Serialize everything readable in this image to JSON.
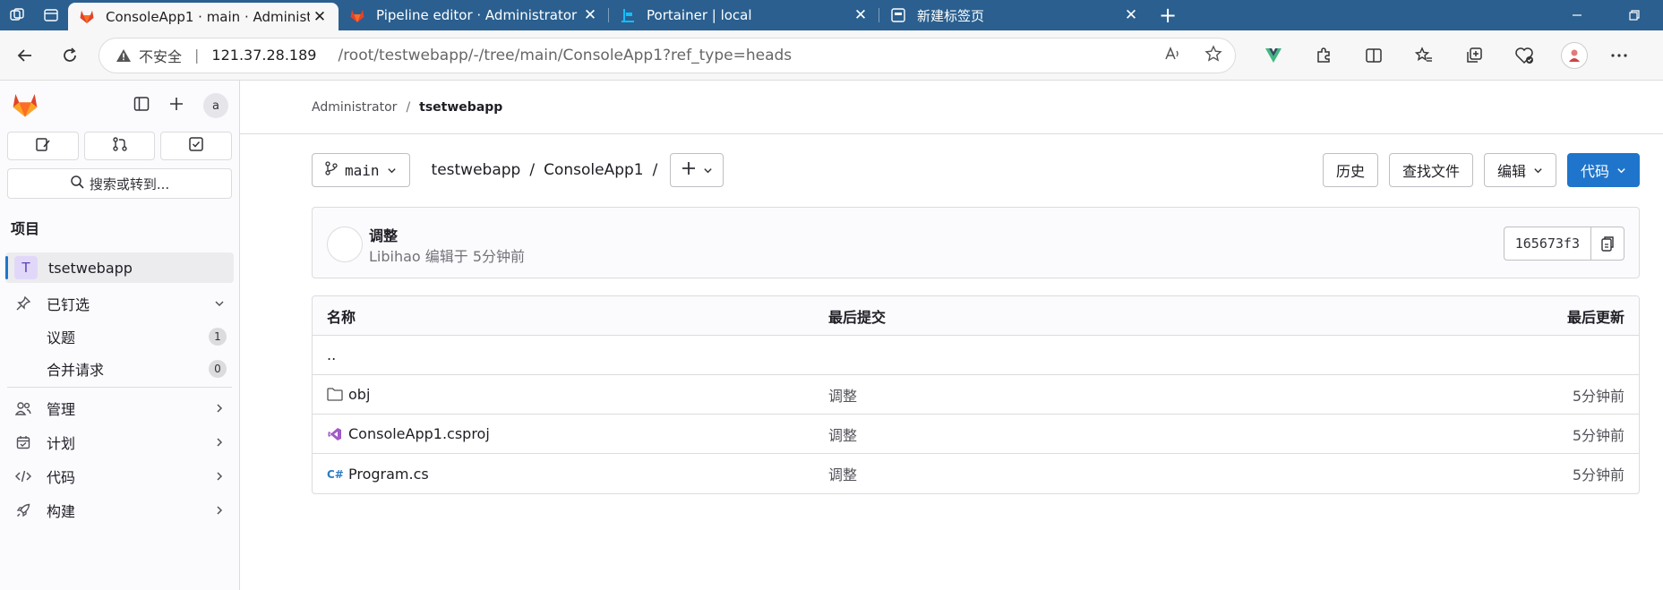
{
  "browser": {
    "tabs": [
      {
        "title": "ConsoleApp1 · main · Administrat",
        "active": true
      },
      {
        "title": "Pipeline editor · Administrator / ts",
        "active": false
      },
      {
        "title": "Portainer | local",
        "active": false
      },
      {
        "title": "新建标签页",
        "active": false
      }
    ],
    "address": {
      "insecure_label": "不安全",
      "host": "121.37.28.189",
      "path": "/root/testwebapp/-/tree/main/ConsoleApp1?ref_type=heads"
    }
  },
  "sidebar": {
    "avatar_alt": "a",
    "search_label": "搜索或转到...",
    "section_heading": "项目",
    "project": {
      "initial": "T",
      "name": "tsetwebapp"
    },
    "pinned_label": "已钉选",
    "pinned_items": [
      {
        "label": "议题",
        "count": "1"
      },
      {
        "label": "合并请求",
        "count": "0"
      }
    ],
    "nav_items": [
      {
        "label": "管理",
        "icon": "users-icon"
      },
      {
        "label": "计划",
        "icon": "calendar-icon"
      },
      {
        "label": "代码",
        "icon": "code-icon"
      },
      {
        "label": "构建",
        "icon": "rocket-icon"
      }
    ]
  },
  "breadcrumb": {
    "parent": "Administrator",
    "current": "tsetwebapp"
  },
  "toolbar": {
    "branch": "main",
    "path": [
      "testwebapp",
      "/",
      "ConsoleApp1",
      "/"
    ],
    "history": "历史",
    "find_file": "查找文件",
    "edit": "编辑",
    "code": "代码"
  },
  "commit": {
    "message": "调整",
    "meta": "Libihao 编辑于 5分钟前",
    "sha": "165673f3"
  },
  "files": {
    "headers": {
      "name": "名称",
      "last_commit": "最后提交",
      "last_update": "最后更新"
    },
    "parent": "..",
    "rows": [
      {
        "name": "obj",
        "icon": "folder-icon",
        "commit": "调整",
        "updated": "5分钟前"
      },
      {
        "name": "ConsoleApp1.csproj",
        "icon": "visualstudio-icon",
        "commit": "调整",
        "updated": "5分钟前"
      },
      {
        "name": "Program.cs",
        "icon": "csharp-icon",
        "commit": "调整",
        "updated": "5分钟前"
      }
    ]
  },
  "colors": {
    "primary": "#1f75cb",
    "tabbar": "#2a5f8f",
    "gitlab_orange": "#e24329"
  }
}
